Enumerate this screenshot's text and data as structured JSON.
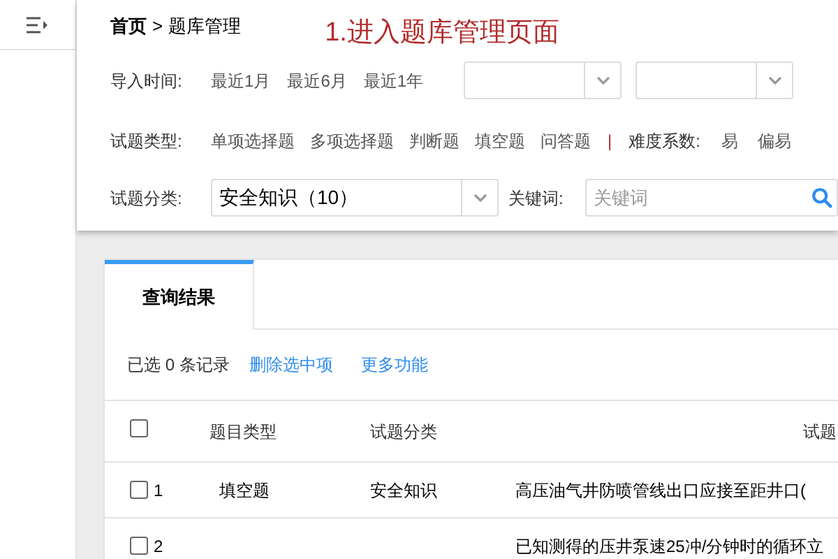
{
  "breadcrumb": {
    "home": "首页",
    "separator": ">",
    "current": "题库管理"
  },
  "annotation": "1.进入题库管理页面",
  "filters": {
    "import_time": {
      "label": "导入时间:",
      "options": [
        {
          "label": "最近1月",
          "selected": false
        },
        {
          "label": "最近6月",
          "selected": false
        },
        {
          "label": "最近1年",
          "selected": false
        }
      ]
    },
    "question_type": {
      "label": "试题类型:",
      "options": [
        {
          "label": "单项选择题",
          "selected": false
        },
        {
          "label": "多项选择题",
          "selected": false
        },
        {
          "label": "判断题",
          "selected": false
        },
        {
          "label": "填空题",
          "selected": false
        },
        {
          "label": "问答题",
          "selected": false
        }
      ]
    },
    "separator": "|",
    "difficulty": {
      "label": "难度系数:",
      "options": [
        {
          "label": "易",
          "selected": false
        },
        {
          "label": "偏易",
          "selected": false
        }
      ]
    },
    "category": {
      "label": "试题分类:",
      "value": "安全知识（10）"
    },
    "keyword": {
      "label": "关键词:",
      "placeholder": "关键词"
    }
  },
  "tabs": [
    {
      "label": "查询结果",
      "selected": true
    }
  ],
  "toolbar": {
    "selection": "已选 0 条记录",
    "links": [
      "删除选中项",
      "更多功能"
    ]
  },
  "table": {
    "header_checked": false,
    "columns": [
      "题目类型",
      "试题分类",
      "试题"
    ],
    "rows": [
      {
        "checked": false,
        "index": "1",
        "type": "填空题",
        "category": "安全知识",
        "question": "高压油气井防喷管线出口应接至距井口("
      },
      {
        "checked": false,
        "index": "2",
        "type": "",
        "category": "",
        "question": "已知测得的压井泵速25冲/分钟时的循环立"
      }
    ]
  }
}
